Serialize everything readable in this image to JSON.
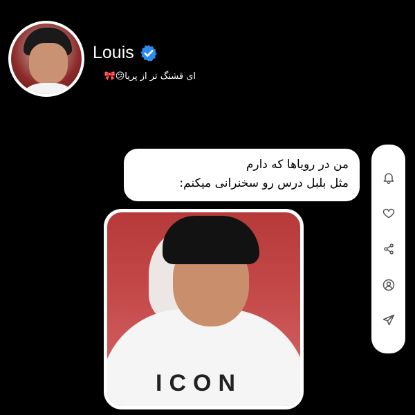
{
  "profile": {
    "name": "Louis",
    "bio": "ای قشنگ تر از پریا😕🎀"
  },
  "message": {
    "lines": [
      "من در رویاها که دارم",
      "مثل بلبل درس رو سخنرانی میکنم:"
    ]
  },
  "photo": {
    "print_text": "ICON"
  },
  "sidebar": {
    "icons": [
      "bell-icon",
      "heart-icon",
      "share-icon",
      "profile-icon",
      "send-icon"
    ]
  },
  "colors": {
    "background": "#000000",
    "verified": "#2b8cf0",
    "bubble": "#ffffff"
  }
}
